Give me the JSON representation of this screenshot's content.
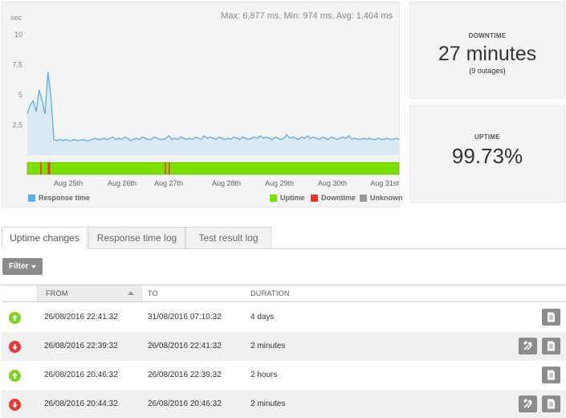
{
  "chart": {
    "stats": "Max: 6,877 ms, Min: 974 ms, Avg: 1,404 ms",
    "y_unit": "sec",
    "y_ticks": [
      "10",
      "7,5",
      "5",
      "2,5"
    ],
    "x_ticks": [
      "Aug 25th",
      "Aug 26th",
      "Aug 27th",
      "Aug 28th",
      "Aug 29th",
      "Aug 30th",
      "Aug 31st"
    ],
    "legend": {
      "response_time": "Response time",
      "uptime": "Uptime",
      "downtime": "Downtime",
      "unknown": "Unknown"
    },
    "colors": {
      "line": "#5aaee6",
      "area": "#dbe9f5",
      "uptime": "#7ee000",
      "downtime": "#e53935",
      "unknown": "#999999"
    }
  },
  "chart_data": {
    "type": "area",
    "title": "",
    "ylabel": "sec",
    "ylim": [
      0,
      12
    ],
    "x_ticks": [
      "Aug 25th",
      "Aug 26th",
      "Aug 27th",
      "Aug 28th",
      "Aug 29th",
      "Aug 30th",
      "Aug 31st"
    ],
    "series": [
      {
        "name": "Response time",
        "values": [
          3.4,
          4.2,
          4.5,
          3.6,
          5.4,
          4.6,
          3.4,
          6.9,
          4.9,
          1.3,
          1.2,
          1.3,
          1.2,
          1.3,
          1.2,
          1.2,
          1.3,
          1.2,
          1.25,
          1.3,
          1.2,
          1.2,
          1.3,
          1.4,
          1.3,
          1.3,
          1.4,
          1.3,
          1.4,
          1.5,
          1.3,
          1.4,
          1.3,
          1.5,
          1.4,
          1.2,
          1.3,
          1.4,
          1.3,
          1.5,
          1.4,
          1.3,
          1.3,
          1.5,
          1.4,
          1.3,
          1.3,
          1.4,
          1.6,
          1.3,
          1.4,
          1.3,
          1.5,
          1.4,
          1.3,
          1.4,
          1.3,
          1.5,
          1.4,
          1.3,
          1.6,
          1.4,
          1.5,
          1.4,
          1.3,
          1.5,
          1.4,
          1.3,
          1.4,
          1.3,
          1.5,
          1.4,
          1.3,
          1.5,
          1.4,
          1.3,
          1.4,
          1.5,
          1.4,
          1.6,
          1.4,
          1.5,
          1.4,
          1.3,
          1.5,
          1.4,
          1.3,
          1.4,
          1.7,
          1.4,
          1.5,
          1.4,
          1.3,
          1.5,
          1.4,
          1.6,
          1.4,
          1.5,
          1.4,
          1.3,
          1.5,
          1.4,
          1.3,
          1.5,
          1.4,
          1.3,
          1.4,
          1.5,
          1.4,
          1.6,
          1.3,
          1.4,
          1.3,
          1.3,
          1.4,
          1.3,
          1.4,
          1.3,
          1.3,
          1.4,
          1.3,
          1.3,
          1.4,
          1.3,
          1.3,
          1.4,
          1.3
        ]
      }
    ],
    "downtime_marks": [
      0.035,
      0.055,
      0.058,
      0.37,
      0.38
    ]
  },
  "downtime": {
    "label": "DOWNTIME",
    "value": "27 minutes",
    "sub": "(9 outages)"
  },
  "uptime": {
    "label": "UPTIME",
    "value": "99.73%"
  },
  "tabs": [
    "Uptime changes",
    "Response time log",
    "Test result log"
  ],
  "filter": {
    "label": "Filter"
  },
  "table": {
    "columns": [
      "FROM",
      "TO",
      "DURATION"
    ],
    "rows": [
      {
        "status": "up",
        "from": "26/08/2016 22:41:32",
        "to": "31/08/2016 07:10:32",
        "duration": "4 days"
      },
      {
        "status": "down",
        "from": "26/08/2016 22:39:32",
        "to": "26/08/2016 22:41:32",
        "duration": "2 minutes"
      },
      {
        "status": "up",
        "from": "26/08/2016 20:46:32",
        "to": "26/08/2016 22:39:32",
        "duration": "2 hours"
      },
      {
        "status": "down",
        "from": "26/08/2016 20:44:32",
        "to": "26/08/2016 20:46:32",
        "duration": "2 minutes"
      }
    ],
    "colors": {
      "up": "#7ed321",
      "down": "#e53935",
      "action": "#8c8c8c"
    },
    "icons": {
      "up": "arrow-up-icon",
      "down": "arrow-down-icon",
      "log": "document-icon",
      "tools": "tools-icon"
    }
  }
}
